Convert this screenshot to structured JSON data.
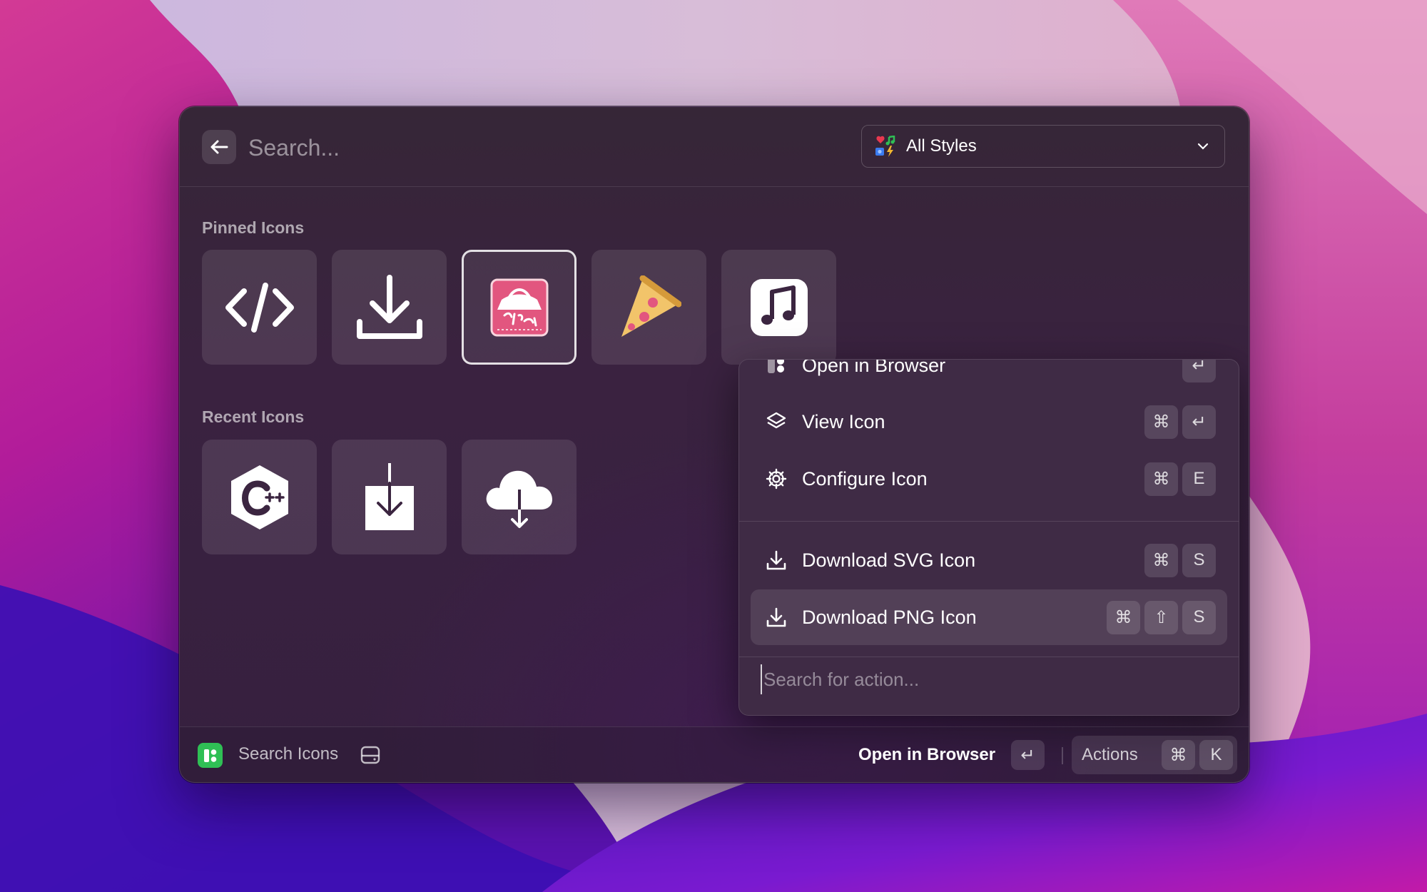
{
  "search": {
    "placeholder": "Search..."
  },
  "style_select": {
    "selected": "All Styles",
    "icon": "emoji-styles-icon"
  },
  "pinned": {
    "title": "Pinned Icons",
    "items": [
      {
        "icon": "code-icon"
      },
      {
        "icon": "download-icon"
      },
      {
        "icon": "pizza-hut-logo-icon"
      },
      {
        "icon": "pizza-slice-icon"
      },
      {
        "icon": "music-note-icon"
      }
    ]
  },
  "recent": {
    "title": "Recent Icons",
    "items": [
      {
        "icon": "cpp-icon"
      },
      {
        "icon": "download-box-icon"
      },
      {
        "icon": "cloud-download-icon"
      }
    ]
  },
  "actions": {
    "items": [
      {
        "label": "Open in Browser",
        "icon": "browser-icon",
        "keys": [
          "↵"
        ]
      },
      {
        "label": "View Icon",
        "icon": "layers-icon",
        "keys": [
          "⌘",
          "↵"
        ]
      },
      {
        "label": "Configure Icon",
        "icon": "gear-icon",
        "keys": [
          "⌘",
          "E"
        ]
      },
      {
        "label": "Download SVG Icon",
        "icon": "download-icon",
        "keys": [
          "⌘",
          "S"
        ]
      },
      {
        "label": "Download PNG Icon",
        "icon": "download-icon",
        "keys": [
          "⌘",
          "⇧",
          "S"
        ]
      }
    ],
    "search_placeholder": "Search for action..."
  },
  "footer": {
    "app_name": "Search Icons",
    "primary_action": "Open in Browser",
    "primary_key": "↵",
    "actions_label": "Actions",
    "actions_keys": [
      "⌘",
      "K"
    ]
  }
}
